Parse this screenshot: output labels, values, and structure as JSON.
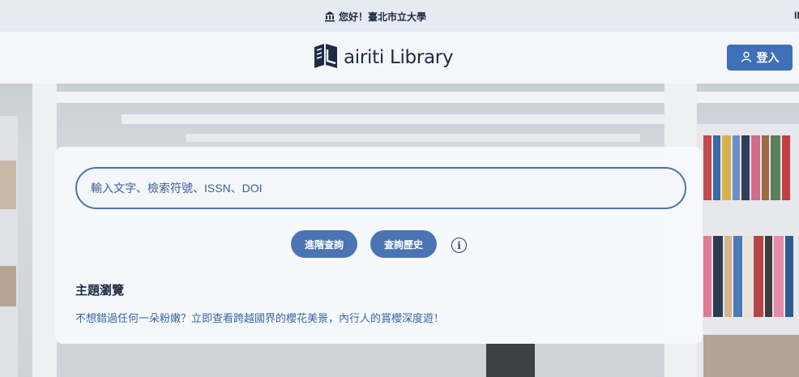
{
  "topbar": {
    "institution": "您好！臺北市立大學",
    "right_fragment": "II"
  },
  "header": {
    "logo_text": "airiti Library",
    "login_label": "登入"
  },
  "search": {
    "placeholder": "輸入文字、檢索符號、ISSN、DOI"
  },
  "actions": {
    "advanced": "進階查詢",
    "history": "查詢歷史"
  },
  "topics": {
    "title": "主題瀏覽",
    "link": "不想錯過任何一朵粉嫩？立即查看跨越國界的櫻花美景，內行人的賞櫻深度遊！"
  },
  "colors": {
    "primary": "#3f6fb8",
    "navy": "#1f2a44",
    "link": "#3a64a8"
  }
}
